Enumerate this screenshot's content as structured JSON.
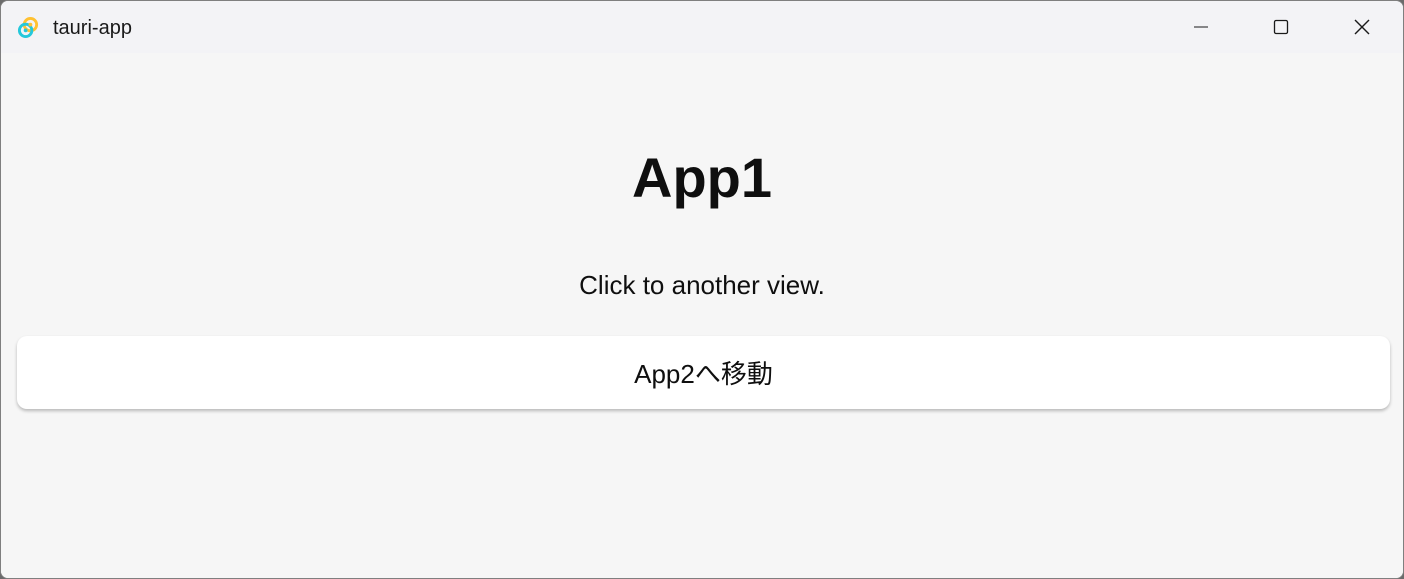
{
  "window": {
    "title": "tauri-app",
    "icon": "tauri-logo-icon",
    "controls": {
      "minimize": "minimize-icon",
      "maximize": "maximize-icon",
      "close": "close-icon"
    }
  },
  "main": {
    "heading": "App1",
    "description": "Click to another view.",
    "button_label": "App2へ移動"
  },
  "colors": {
    "titlebar": "#f3f3f6",
    "background": "#f6f6f6",
    "button": "#ffffff",
    "text": "#0f0f0f",
    "logo_yellow": "#ffc131",
    "logo_blue": "#24c8db"
  }
}
